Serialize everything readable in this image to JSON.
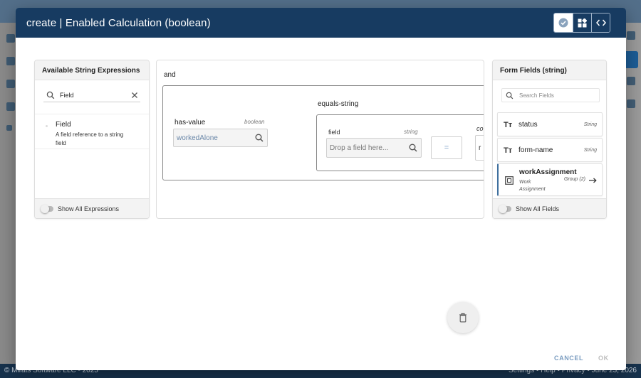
{
  "background": {
    "footer_left": "© Mirats Software LLC - 2025",
    "footer_right": "Settings • Help • Privacy • June 23, 2026"
  },
  "modal": {
    "title": "create | Enabled Calculation (boolean)",
    "mode_buttons": [
      {
        "icon": "check-circle-icon",
        "active": true
      },
      {
        "icon": "blocks-icon",
        "active": false
      },
      {
        "icon": "code-icon",
        "active": false
      }
    ]
  },
  "left_panel": {
    "title": "Available String Expressions",
    "search_value": "Field",
    "items": [
      {
        "name": "Field",
        "description": "A field reference to a string field"
      }
    ],
    "toggle_label": "Show All Expressions"
  },
  "canvas": {
    "root_operator": "and",
    "has_value": {
      "label": "has-value",
      "type": "boolean",
      "input_value": "workedAlone"
    },
    "equals_string": {
      "label": "equals-string",
      "field_label": "field",
      "field_type": "string",
      "field_placeholder": "Drop a field here...",
      "operator": "=",
      "compare_label": "co",
      "compare_value_partial": "r"
    }
  },
  "right_panel": {
    "title": "Form Fields (string)",
    "search_placeholder": "Search Fields",
    "fields": [
      {
        "name": "status",
        "type": "String",
        "icon": "text-type-icon"
      },
      {
        "name": "form-name",
        "type": "String",
        "icon": "text-type-icon"
      },
      {
        "name": "workAssignment",
        "subtitle": "Work Assignment",
        "type": "Group (2)",
        "icon": "group-icon"
      }
    ],
    "toggle_label": "Show All Fields"
  },
  "footer": {
    "cancel_label": "CANCEL",
    "ok_label": "OK"
  },
  "colors": {
    "header_bg": "#173b61",
    "accent": "#3e6f9e",
    "link_blue": "#6a87a8",
    "cancel_text": "#7a9cc0",
    "ok_disabled": "#bdbdbd"
  }
}
